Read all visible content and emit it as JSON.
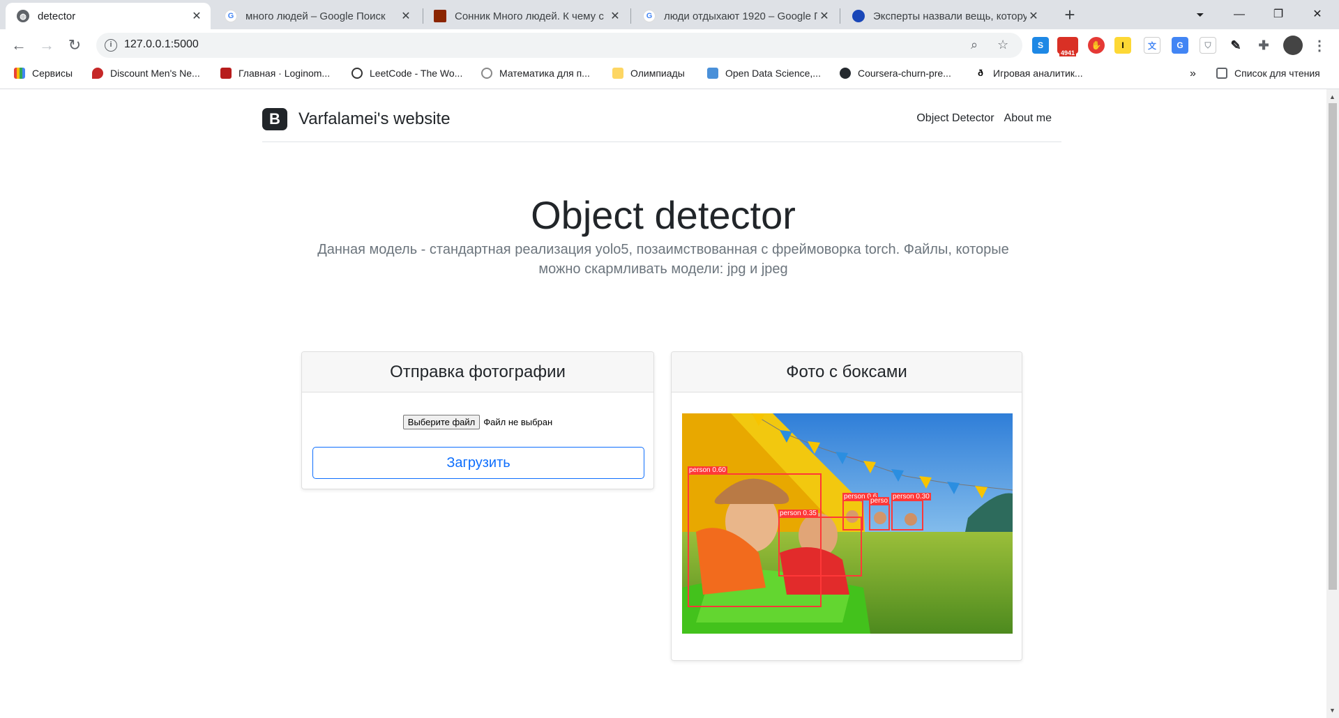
{
  "browser": {
    "tabs": [
      {
        "title": "detector",
        "active": true
      },
      {
        "title": "много людей – Google Поиск",
        "active": false
      },
      {
        "title": "Сонник Много людей. К чему с",
        "active": false
      },
      {
        "title": "люди отдыхают 1920 – Google П",
        "active": false
      },
      {
        "title": "Эксперты назвали вещь, котору",
        "active": false
      }
    ],
    "url": "127.0.0.1:5000",
    "extensions": {
      "mail_badge": "4941"
    },
    "bookmarks": [
      "Сервисы",
      "Discount Men's Ne...",
      "Главная · Loginom...",
      "LeetCode - The Wo...",
      "Математика для п...",
      "Олимпиады",
      "Open Data Science,...",
      "Coursera-churn-pre...",
      "Игровая аналитик..."
    ],
    "bookmarks_more": "»",
    "reading_list": "Список для чтения"
  },
  "site": {
    "brand_logo": "B",
    "brand_name": "Varfalamei's website",
    "nav": [
      "Object Detector",
      "About me"
    ]
  },
  "hero": {
    "title": "Object detector",
    "text": "Данная модель - стандартная реализация yolo5, позаимствованная с фреймоворка torch. Файлы, которые можно скармливать модели: jpg и jpeg"
  },
  "upload_card": {
    "title": "Отправка фотографии",
    "file_button": "Выберите файл",
    "file_status": "Файл не выбран",
    "submit_label": "Загрузить"
  },
  "result_card": {
    "title": "Фото с боксами",
    "detections": [
      {
        "label": "person 0.60"
      },
      {
        "label": "person 0.35"
      },
      {
        "label": "person 0.6"
      },
      {
        "label": "perso"
      },
      {
        "label": "person 0.30"
      }
    ]
  },
  "colors": {
    "primary": "#0d6efd",
    "box": "#ff3838"
  }
}
